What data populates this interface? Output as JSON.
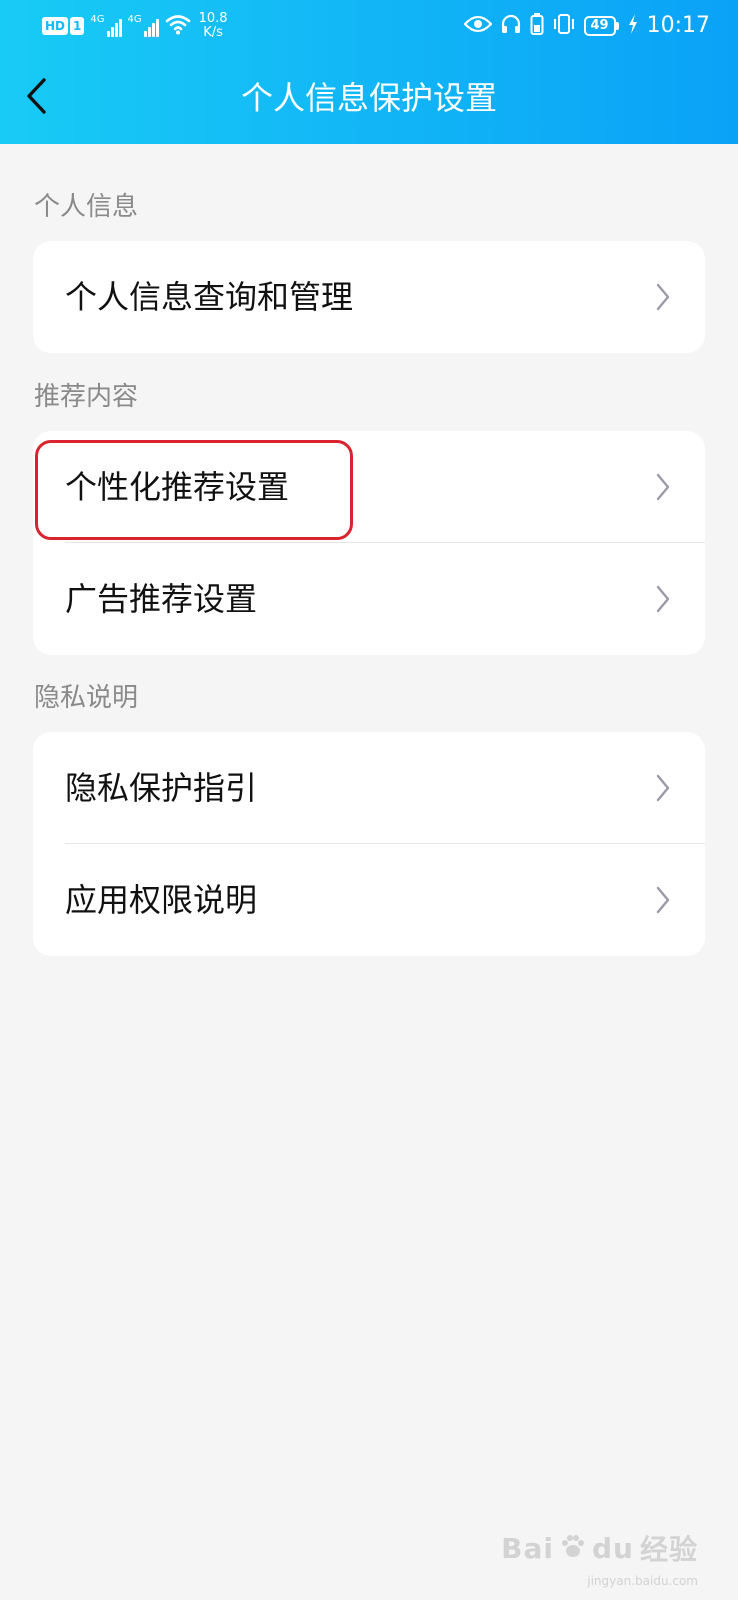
{
  "status_bar": {
    "hd_label": "HD",
    "sim1_label": "1",
    "net1_label": "4G",
    "net2_label": "4G",
    "speed_value": "10.8",
    "speed_unit": "K/s",
    "battery_level": "49",
    "time": "10:17"
  },
  "nav": {
    "title": "个人信息保护设置",
    "back_icon": "chevron-left-icon"
  },
  "sections": [
    {
      "label": "个人信息",
      "items": [
        {
          "label": "个人信息查询和管理"
        }
      ]
    },
    {
      "label": "推荐内容",
      "items": [
        {
          "label": "个性化推荐设置"
        },
        {
          "label": "广告推荐设置"
        }
      ]
    },
    {
      "label": "隐私说明",
      "items": [
        {
          "label": "隐私保护指引"
        },
        {
          "label": "应用权限说明"
        }
      ]
    }
  ],
  "highlight": {
    "target": "个性化推荐设置",
    "color": "#d9232e"
  },
  "watermark": {
    "brand": "Bai",
    "brand2": "du",
    "suffix": "经验",
    "url": "jingyan.baidu.com"
  },
  "colors": {
    "header_gradient_start": "#18cbf5",
    "header_gradient_end": "#0aa2f7",
    "background": "#f5f5f5",
    "chevron": "#9a9aa8"
  }
}
